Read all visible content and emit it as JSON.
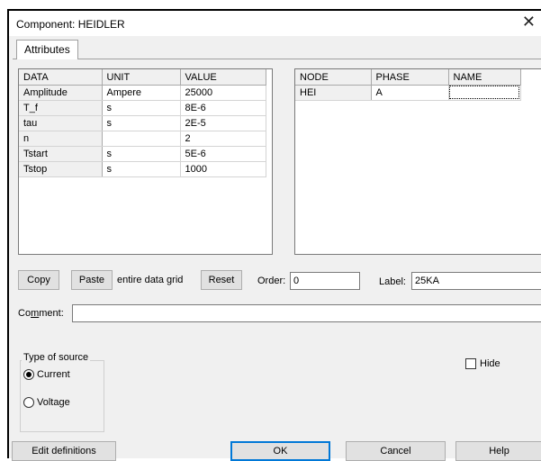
{
  "window": {
    "title": "Component: HEIDLER",
    "close_glyph": "✕"
  },
  "tabs": [
    {
      "label": "Attributes",
      "active": true
    }
  ],
  "data_grid": {
    "columns": [
      "DATA",
      "UNIT",
      "VALUE"
    ],
    "rows": [
      [
        "Amplitude",
        "Ampere",
        "25000"
      ],
      [
        "T_f",
        "s",
        "8E-6"
      ],
      [
        "tau",
        "s",
        "2E-5"
      ],
      [
        "n",
        "",
        "2"
      ],
      [
        "Tstart",
        "s",
        "5E-6"
      ],
      [
        "Tstop",
        "s",
        "1000"
      ]
    ]
  },
  "node_grid": {
    "columns": [
      "NODE",
      "PHASE",
      "NAME"
    ],
    "rows": [
      [
        "HEI",
        "A",
        ""
      ]
    ]
  },
  "grid_controls": {
    "copy": "Copy",
    "paste": "Paste",
    "entire_data_grid": "entire data grid",
    "reset": "Reset",
    "order_label": "Order:",
    "order_value": "0",
    "label_label": "Label:",
    "label_value": "25KA"
  },
  "comment": {
    "label_prefix": "Co",
    "label_mnemonic": "m",
    "label_suffix": "ment:",
    "value": ""
  },
  "source_type": {
    "title": "Type of source",
    "options": [
      {
        "label": "Current",
        "selected": true
      },
      {
        "label": "Voltage",
        "selected": false
      }
    ]
  },
  "hide": {
    "label": "Hide",
    "checked": false
  },
  "footer": {
    "edit_definitions": "Edit definitions",
    "ok": "OK",
    "cancel": "Cancel",
    "help": "Help"
  }
}
